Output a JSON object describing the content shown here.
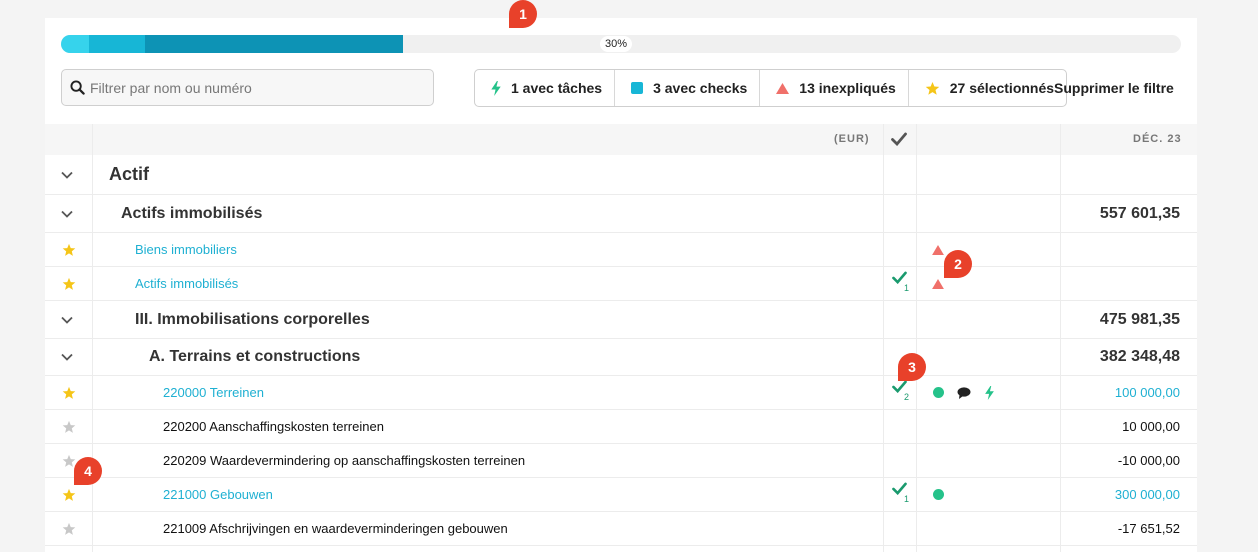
{
  "progress": {
    "label": "30%",
    "segments": [
      0.025,
      0.05,
      0.23
    ]
  },
  "markers": [
    "1",
    "2",
    "3",
    "4"
  ],
  "search": {
    "placeholder": "Filtrer par nom ou numéro"
  },
  "filters": [
    {
      "icon": "bolt-icon",
      "label": "1 avec tâches",
      "color": "#25c28a"
    },
    {
      "icon": "square-icon",
      "label": "3 avec checks",
      "color": "#17b6d6"
    },
    {
      "icon": "triangle-icon",
      "label": "13 inexpliqués",
      "color": "#f0706a"
    },
    {
      "icon": "star-icon",
      "label": "27 sélectionnés",
      "color": "#f5c518"
    }
  ],
  "clear_filter_label": "Supprimer le filtre",
  "table": {
    "currency_header": "(EUR)",
    "period_header": "DÉC. 23",
    "rows": [
      {
        "label": "Actif",
        "amount": ""
      },
      {
        "label": "Actifs immobilisés",
        "amount": "557 601,35"
      },
      {
        "label": "Biens immobiliers",
        "amount": ""
      },
      {
        "label": "Actifs immobilisés",
        "amount": "",
        "check_count": "1"
      },
      {
        "label": "III. Immobilisations corporelles",
        "amount": "475 981,35"
      },
      {
        "label": "A. Terrains et constructions",
        "amount": "382 348,48"
      },
      {
        "label": "220000 Terreinen",
        "amount": "100 000,00",
        "check_count": "2"
      },
      {
        "label": "220200 Aanschaffingskosten terreinen",
        "amount": "10 000,00"
      },
      {
        "label": "220209 Waardevermindering op aanschaffingskosten terreinen",
        "amount": "-10 000,00"
      },
      {
        "label": "221000 Gebouwen",
        "amount": "300 000,00",
        "check_count": "1"
      },
      {
        "label": "221009 Afschrijvingen en waardeverminderingen gebouwen",
        "amount": "-17 651,52"
      }
    ]
  },
  "colors": {
    "accent": "#1fb0d2",
    "marker": "#e8412a",
    "star_active": "#f5c518",
    "star_inactive": "#c8c8c8",
    "check": "#1a9a6e"
  }
}
